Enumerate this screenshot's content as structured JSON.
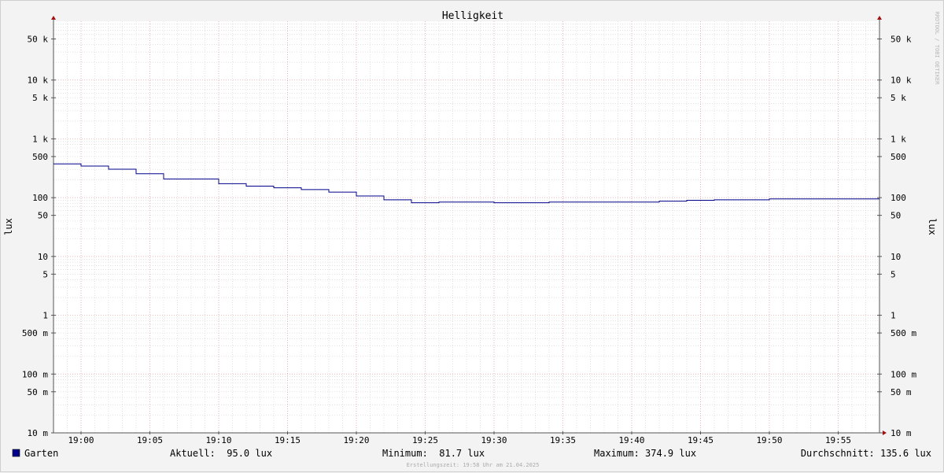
{
  "chart_data": {
    "type": "line",
    "title": "Helligkeit",
    "ylabel_left": "lux",
    "ylabel_right": "lux",
    "watermark": "RRDTOOL / TOBI OETIKER",
    "y_scale": "log",
    "ylim": [
      0.01,
      100000
    ],
    "y_ticks": [
      {
        "value": 50000,
        "label": "50 k"
      },
      {
        "value": 10000,
        "label": "10 k"
      },
      {
        "value": 5000,
        "label": "5 k"
      },
      {
        "value": 1000,
        "label": "1 k"
      },
      {
        "value": 500,
        "label": "500"
      },
      {
        "value": 100,
        "label": "100"
      },
      {
        "value": 50,
        "label": "50"
      },
      {
        "value": 10,
        "label": "10"
      },
      {
        "value": 5,
        "label": "5"
      },
      {
        "value": 1,
        "label": "1"
      },
      {
        "value": 0.5,
        "label": "500 m"
      },
      {
        "value": 0.1,
        "label": "100 m"
      },
      {
        "value": 0.05,
        "label": "50 m"
      },
      {
        "value": 0.01,
        "label": "10 m"
      }
    ],
    "x_range": [
      "18:58",
      "19:58"
    ],
    "x_ticks": [
      "19:00",
      "19:05",
      "19:10",
      "19:15",
      "19:20",
      "19:25",
      "19:30",
      "19:35",
      "19:40",
      "19:45",
      "19:50",
      "19:55"
    ],
    "series": [
      {
        "name": "Garten",
        "color": "#00008b",
        "step": true,
        "points": [
          [
            "18:58",
            375
          ],
          [
            "19:00",
            345
          ],
          [
            "19:02",
            305
          ],
          [
            "19:04",
            255
          ],
          [
            "19:06",
            208
          ],
          [
            "19:10",
            173
          ],
          [
            "19:12",
            157
          ],
          [
            "19:14",
            147
          ],
          [
            "19:16",
            137
          ],
          [
            "19:18",
            124
          ],
          [
            "19:20",
            107
          ],
          [
            "19:22",
            92
          ],
          [
            "19:24",
            82
          ],
          [
            "19:26",
            84
          ],
          [
            "19:30",
            82
          ],
          [
            "19:34",
            84
          ],
          [
            "19:42",
            87
          ],
          [
            "19:44",
            90
          ],
          [
            "19:46",
            92
          ],
          [
            "19:50",
            95
          ],
          [
            "19:58",
            95
          ]
        ]
      }
    ]
  },
  "legend": {
    "series_name": "Garten",
    "series_color": "#00008b",
    "current": "Aktuell:  95.0 lux",
    "minimum": "Minimum:  81.7 lux",
    "maximum": "Maximum: 374.9 lux",
    "average": "Durchschnitt: 135.6 lux"
  },
  "footer": "Erstellungszeit: 19:58 Uhr am 21.04.2025",
  "colors": {
    "background": "#f3f3f3",
    "canvas": "#ffffff",
    "major_grid": "#e8a0a0",
    "minor_grid": "#d0d0d0",
    "axis": "#555555",
    "arrow": "#a01010"
  }
}
